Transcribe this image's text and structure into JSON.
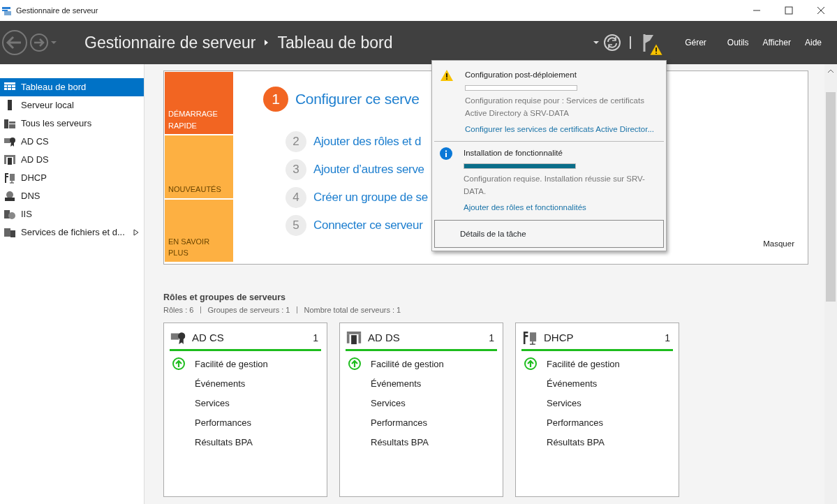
{
  "window": {
    "title": "Gestionnaire de serveur"
  },
  "header": {
    "breadcrumb": [
      "Gestionnaire de serveur",
      "Tableau de bord"
    ],
    "menus": [
      "Gérer",
      "Outils",
      "Afficher",
      "Aide"
    ]
  },
  "sidebar": {
    "items": [
      {
        "label": "Tableau de bord",
        "selected": true,
        "has_children": false
      },
      {
        "label": "Serveur local",
        "selected": false,
        "has_children": false
      },
      {
        "label": "Tous les serveurs",
        "selected": false,
        "has_children": false
      },
      {
        "label": "AD CS",
        "selected": false,
        "has_children": false
      },
      {
        "label": "AD DS",
        "selected": false,
        "has_children": false
      },
      {
        "label": "DHCP",
        "selected": false,
        "has_children": false
      },
      {
        "label": "DNS",
        "selected": false,
        "has_children": false
      },
      {
        "label": "IIS",
        "selected": false,
        "has_children": false
      },
      {
        "label": "Services de fichiers et d...",
        "selected": false,
        "has_children": true
      }
    ]
  },
  "quick_start": {
    "tiles": [
      {
        "label": "DÉMARRAGE RAPIDE",
        "color": "#f26522"
      },
      {
        "label": "NOUVEAUTÉS",
        "color": "#fdb042"
      },
      {
        "label": "EN SAVOIR PLUS",
        "color": "#fdb042"
      }
    ],
    "steps": [
      {
        "number": "1",
        "label": "Configurer ce serve",
        "kind": "primary"
      },
      {
        "number": "2",
        "label": "Ajouter des rôles et d",
        "kind": "secondary"
      },
      {
        "number": "3",
        "label": "Ajouter d’autres serve",
        "kind": "secondary"
      },
      {
        "number": "4",
        "label": "Créer un groupe de se",
        "kind": "secondary"
      },
      {
        "number": "5",
        "label": "Connecter ce serveur",
        "kind": "secondary"
      }
    ],
    "hide_link": "Masquer"
  },
  "roles": {
    "title": "Rôles et groupes de serveurs",
    "summary": [
      "Rôles : 6",
      "Groupes de serveurs : 1",
      "Nombre total de serveurs : 1"
    ],
    "cards": [
      {
        "name": "AD CS",
        "count": "1",
        "rows": [
          {
            "label": "Facilité de gestion",
            "healthy": true
          },
          {
            "label": "Événements",
            "healthy": false
          },
          {
            "label": "Services",
            "healthy": false
          },
          {
            "label": "Performances",
            "healthy": false
          },
          {
            "label": "Résultats BPA",
            "healthy": false
          }
        ]
      },
      {
        "name": "AD DS",
        "count": "1",
        "rows": [
          {
            "label": "Facilité de gestion",
            "healthy": true
          },
          {
            "label": "Événements",
            "healthy": false
          },
          {
            "label": "Services",
            "healthy": false
          },
          {
            "label": "Performances",
            "healthy": false
          },
          {
            "label": "Résultats BPA",
            "healthy": false
          }
        ]
      },
      {
        "name": "DHCP",
        "count": "1",
        "rows": [
          {
            "label": "Facilité de gestion",
            "healthy": true
          },
          {
            "label": "Événements",
            "healthy": false
          },
          {
            "label": "Services",
            "healthy": false
          },
          {
            "label": "Performances",
            "healthy": false
          },
          {
            "label": "Résultats BPA",
            "healthy": false
          }
        ]
      }
    ]
  },
  "notifications": {
    "items": [
      {
        "kind": "warning",
        "title": "Configuration post-déploiement",
        "level": 0,
        "message": "Configuration requise pour : Services de certificats Active Directory à SRV-DATA",
        "link": "Configurer les services de certificats Active Director..."
      },
      {
        "kind": "info",
        "title": "Installation de fonctionnalité",
        "level": 1,
        "message": "Configuration requise. Installation réussie sur SRV-DATA.",
        "link": "Ajouter des rôles et fonctionnalités"
      }
    ],
    "details_button": "Détails de la tâche"
  }
}
